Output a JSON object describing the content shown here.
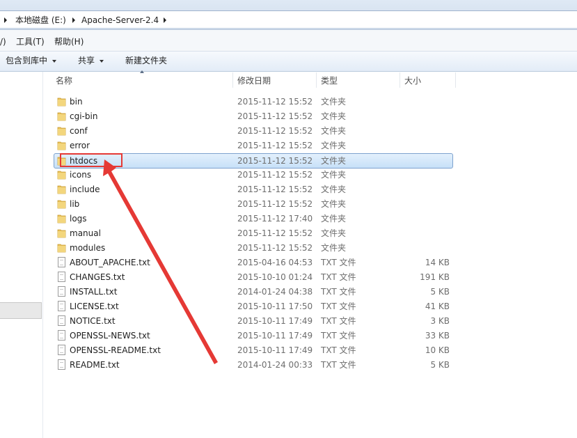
{
  "address_bar": {
    "breadcrumbs": [
      "本地磁盘 (E:)",
      "Apache-Server-2.4"
    ]
  },
  "menu_bar": {
    "items": [
      "/)",
      "工具(T)",
      "帮助(H)"
    ]
  },
  "toolbar": {
    "include_in_library": "包含到库中",
    "share": "共享",
    "new_folder": "新建文件夹"
  },
  "columns": {
    "name": "名称",
    "date_modified": "修改日期",
    "type": "类型",
    "size": "大小"
  },
  "files": [
    {
      "name": "bin",
      "date": "2015-11-12 15:52",
      "type": "文件夹",
      "size": "",
      "kind": "folder-icon"
    },
    {
      "name": "cgi-bin",
      "date": "2015-11-12 15:52",
      "type": "文件夹",
      "size": "",
      "kind": "folder-icon"
    },
    {
      "name": "conf",
      "date": "2015-11-12 15:52",
      "type": "文件夹",
      "size": "",
      "kind": "folder-icon"
    },
    {
      "name": "error",
      "date": "2015-11-12 15:52",
      "type": "文件夹",
      "size": "",
      "kind": "folder-icon"
    },
    {
      "name": "htdocs",
      "date": "2015-11-12 15:52",
      "type": "文件夹",
      "size": "",
      "kind": "folder-icon",
      "selected": true
    },
    {
      "name": "icons",
      "date": "2015-11-12 15:52",
      "type": "文件夹",
      "size": "",
      "kind": "folder-icon"
    },
    {
      "name": "include",
      "date": "2015-11-12 15:52",
      "type": "文件夹",
      "size": "",
      "kind": "folder-icon"
    },
    {
      "name": "lib",
      "date": "2015-11-12 15:52",
      "type": "文件夹",
      "size": "",
      "kind": "folder-icon"
    },
    {
      "name": "logs",
      "date": "2015-11-12 17:40",
      "type": "文件夹",
      "size": "",
      "kind": "folder-icon"
    },
    {
      "name": "manual",
      "date": "2015-11-12 15:52",
      "type": "文件夹",
      "size": "",
      "kind": "folder-icon"
    },
    {
      "name": "modules",
      "date": "2015-11-12 15:52",
      "type": "文件夹",
      "size": "",
      "kind": "folder-icon"
    },
    {
      "name": "ABOUT_APACHE.txt",
      "date": "2015-04-16 04:53",
      "type": "TXT 文件",
      "size": "14 KB",
      "kind": "text-file-icon"
    },
    {
      "name": "CHANGES.txt",
      "date": "2015-10-10 01:24",
      "type": "TXT 文件",
      "size": "191 KB",
      "kind": "text-file-icon"
    },
    {
      "name": "INSTALL.txt",
      "date": "2014-01-24 04:38",
      "type": "TXT 文件",
      "size": "5 KB",
      "kind": "text-file-icon"
    },
    {
      "name": "LICENSE.txt",
      "date": "2015-10-11 17:50",
      "type": "TXT 文件",
      "size": "41 KB",
      "kind": "text-file-icon"
    },
    {
      "name": "NOTICE.txt",
      "date": "2015-10-11 17:49",
      "type": "TXT 文件",
      "size": "3 KB",
      "kind": "text-file-icon"
    },
    {
      "name": "OPENSSL-NEWS.txt",
      "date": "2015-10-11 17:49",
      "type": "TXT 文件",
      "size": "33 KB",
      "kind": "text-file-icon"
    },
    {
      "name": "OPENSSL-README.txt",
      "date": "2015-10-11 17:49",
      "type": "TXT 文件",
      "size": "10 KB",
      "kind": "text-file-icon"
    },
    {
      "name": "README.txt",
      "date": "2014-01-24 00:33",
      "type": "TXT 文件",
      "size": "5 KB",
      "kind": "text-file-icon"
    }
  ],
  "annotation": {
    "highlight_color": "#e53935"
  }
}
